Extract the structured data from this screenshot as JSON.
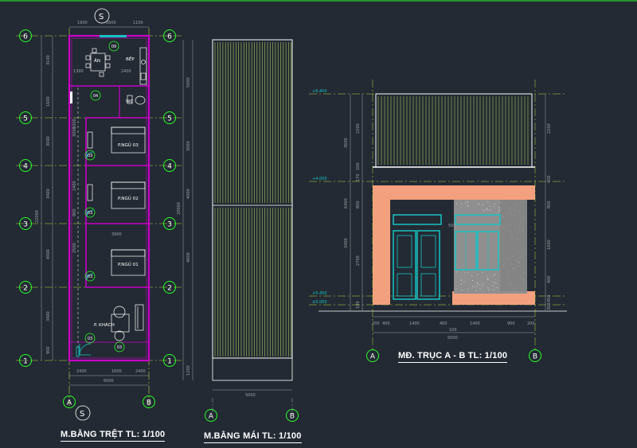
{
  "colors": {
    "background": "#232a33",
    "dim": "#9aa0a6",
    "axis_circle": "#2bff2b",
    "axis_line": "#bcd84a",
    "wall": "#c800c8",
    "wall_facade": "#ffffff",
    "furniture": "#ffffff",
    "door": "#17c3c3",
    "facade_fill": "#f3a07f",
    "stone": "#9b9b9b",
    "roof_line": "#a8c85a",
    "label": "#ffffff"
  },
  "titles": {
    "ground_plan": "M.BẰNG TRỆT TL: 1/100",
    "roof_plan": "M.BẰNG MÁI TL: 1/100",
    "elevation": "MĐ. TRỤC A - B  TL: 1/100"
  },
  "north_labels": [
    "S",
    "S"
  ],
  "axes": {
    "rows": [
      "6",
      "5",
      "4",
      "3",
      "2",
      "1"
    ],
    "cols": [
      "A",
      "B"
    ]
  },
  "rooms": {
    "an": "ĂN",
    "bep": "BẾP",
    "wc": "WC",
    "ngu3": "P.NGỦ 03",
    "ngu2": "P.NGỦ 02",
    "ngu1": "P.NGỦ 01",
    "khach": "P. KHÁCH"
  },
  "bubbles": [
    "09",
    "04",
    "03",
    "03",
    "03",
    "03",
    "03",
    "01",
    "02"
  ],
  "dims": {
    "plan_top": [
      "1900",
      "2600",
      "1100"
    ],
    "plan_kitchen": [
      "1300",
      "2400"
    ],
    "plan_left_total": "22000",
    "plan_left": [
      "3100",
      "1600",
      "3000",
      "3400",
      "4000",
      "3400",
      "900"
    ],
    "plan_mid": [
      "1000",
      "3000",
      "2400",
      "900",
      "2500",
      "3200"
    ],
    "plan_room_width": "3900",
    "plan_bottom": [
      "2400",
      "1600",
      "2400"
    ],
    "plan_bottom_total": "6000",
    "roof_right": [
      "5000",
      "3000",
      "4000",
      "4600",
      "1200"
    ],
    "roof_total": "20000",
    "roof_bottom": "5000",
    "elev_left": [
      "3600",
      "2200",
      "100",
      "170",
      "6400",
      "800",
      "3400",
      "2700",
      "100"
    ],
    "elev_right": [
      "2200",
      "400",
      "800",
      "1600",
      "400",
      "450",
      "300",
      "150"
    ],
    "elev_bottom": [
      "200",
      "400",
      "1400",
      "400",
      "1400",
      "900",
      "200"
    ],
    "elev_total": "5000",
    "elev_mid": "100",
    "elev_small": "500"
  },
  "levels": [
    "+6.400",
    "+4.000",
    "+0.450",
    "±0.000"
  ]
}
